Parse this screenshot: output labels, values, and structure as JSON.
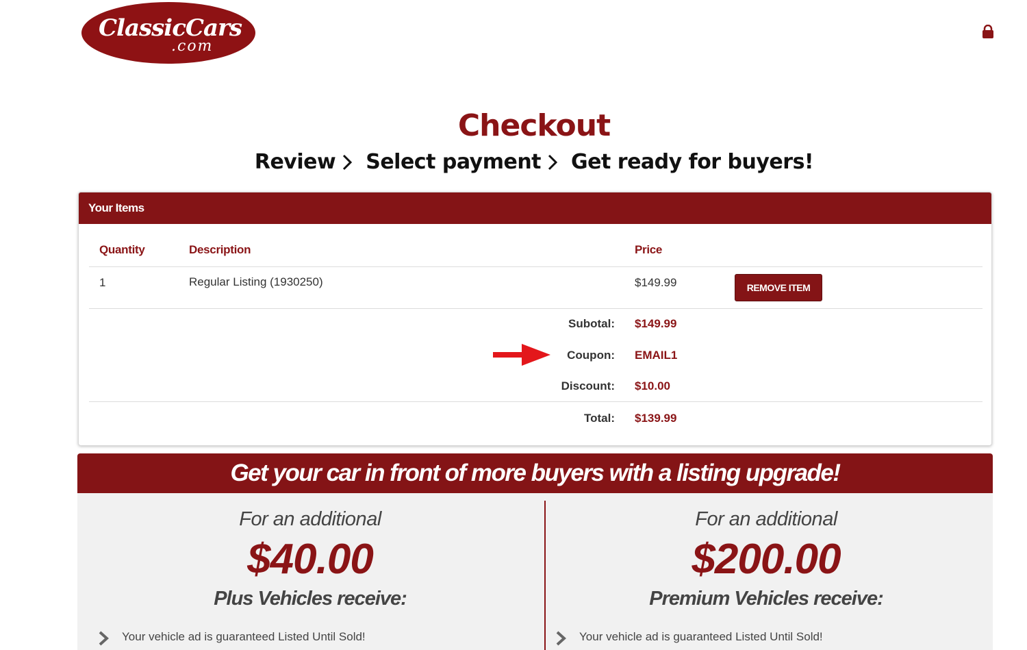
{
  "header": {
    "logo_text_main": "ClassicCars",
    "logo_text_sub": ".com",
    "lock_icon": "lock-icon"
  },
  "page": {
    "title": "Checkout",
    "steps": [
      "Review",
      "Select payment",
      "Get ready for buyers!"
    ]
  },
  "cart": {
    "heading": "Your Items",
    "columns": {
      "quantity": "Quantity",
      "description": "Description",
      "price": "Price"
    },
    "items": [
      {
        "quantity": "1",
        "description": "Regular Listing (1930250)",
        "price": "$149.99",
        "remove_label": "REMOVE ITEM"
      }
    ],
    "summary": {
      "subtotal_label": "Subotal:",
      "subtotal": "$149.99",
      "coupon_label": "Coupon:",
      "coupon": "EMAIL1",
      "discount_label": "Discount:",
      "discount": "$10.00",
      "total_label": "Total:",
      "total": "$139.99"
    }
  },
  "upgrade": {
    "banner": "Get your car in front of more buyers with a listing upgrade!",
    "plans": [
      {
        "prefix": "For an additional",
        "price": "$40.00",
        "receive": "Plus Vehicles receive:",
        "feature": "Your vehicle ad is guaranteed Listed Until Sold!"
      },
      {
        "prefix": "For an additional",
        "price": "$200.00",
        "receive": "Premium Vehicles receive:",
        "feature": "Your vehicle ad is guaranteed Listed Until Sold!"
      }
    ]
  },
  "colors": {
    "brand": "#841416",
    "panel": "#f1f1f1",
    "arrow": "#e3171b"
  }
}
